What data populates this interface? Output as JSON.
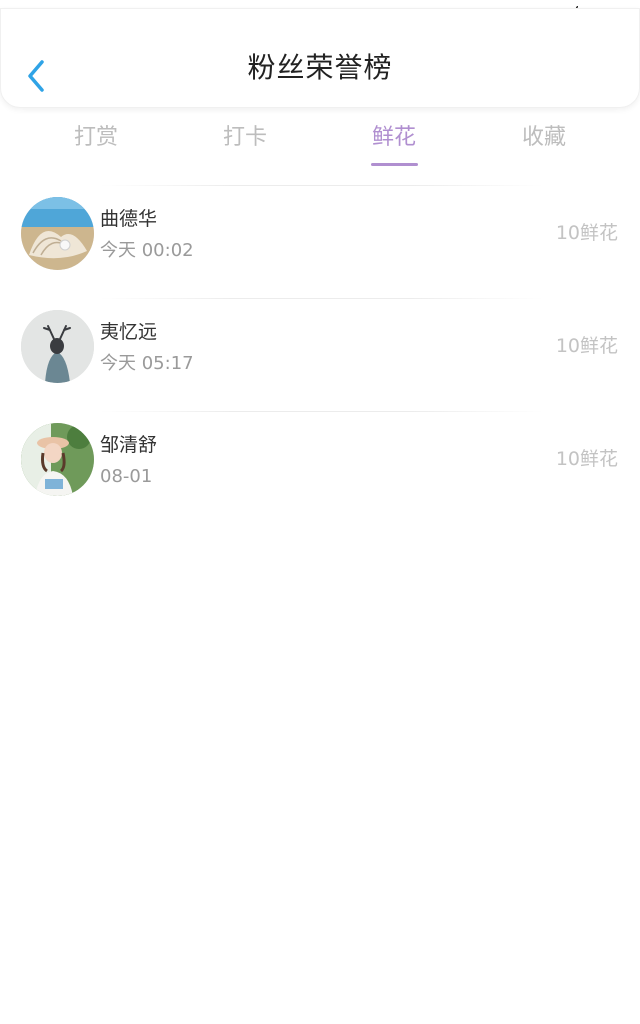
{
  "header": {
    "title": "粉丝荣誉榜"
  },
  "tabs": [
    {
      "label": "打赏",
      "active": false
    },
    {
      "label": "打卡",
      "active": false
    },
    {
      "label": "鲜花",
      "active": true
    },
    {
      "label": "收藏",
      "active": false
    }
  ],
  "fans": [
    {
      "name": "曲德华",
      "time": "今天 00:02",
      "amount": "10鲜花",
      "avatar": "seashell-pearl-avatar"
    },
    {
      "name": "夷忆远",
      "time": "今天 05:17",
      "amount": "10鲜花",
      "avatar": "antlered-figure-avatar"
    },
    {
      "name": "邹清舒",
      "time": "08-01",
      "amount": "10鲜花",
      "avatar": "girl-with-hat-avatar"
    }
  ],
  "colors": {
    "accent": "#b08fd0",
    "back_arrow": "#2fa3e6",
    "inactive_tab": "#bdbdbd"
  }
}
